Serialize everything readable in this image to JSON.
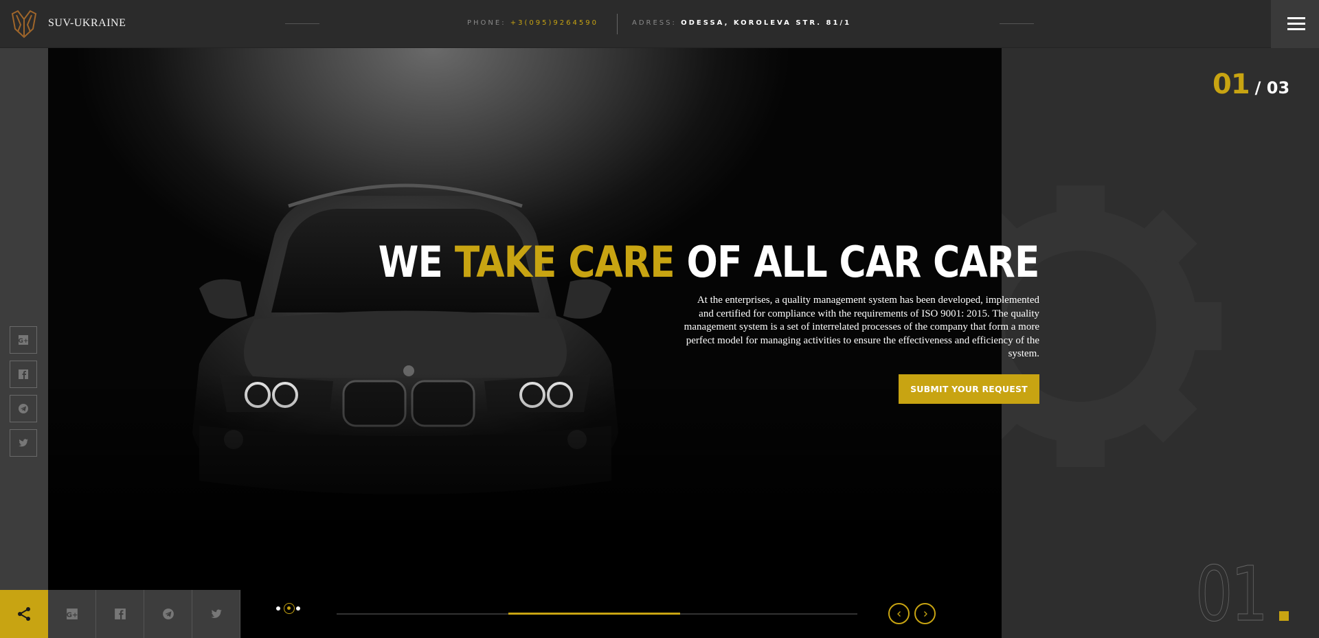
{
  "header": {
    "brand": "SUV-UKRAINE",
    "phone_label": "PHONE:",
    "phone_value": "+3(095)9264590",
    "address_label": "ADRESS:",
    "address_value": "ODESSA, KOROLEVA STR. 81/1",
    "menu_icon": "hamburger-icon"
  },
  "sidebar": {
    "icons": [
      "google-plus-icon",
      "facebook-icon",
      "telegram-icon",
      "twitter-icon"
    ]
  },
  "hero": {
    "headline_pre": "WE ",
    "headline_accent": "TAKE CARE",
    "headline_post": " OF ALL CAR CARE",
    "description": "At the enterprises, a quality management system has been developed, implemented and certified for compliance with the requirements of ISO 9001: 2015. The quality management system is a set of interrelated processes of the company that form a more perfect model for managing activities to ensure the effectiveness and efficiency of the system.",
    "cta_label": "SUBMIT YOUR REQUEST"
  },
  "slider": {
    "current": "01",
    "total": "/ 03",
    "big_number": "01",
    "active_dot": 2,
    "progress_fraction": 0.33
  },
  "bottom_bar": {
    "share_icon": "share-icon",
    "social_icons": [
      "google-plus-icon",
      "facebook-icon",
      "telegram-icon",
      "twitter-icon"
    ]
  },
  "colors": {
    "accent": "#c8a412",
    "background": "#2d2d2d",
    "sidebar": "#3d3d3d"
  }
}
